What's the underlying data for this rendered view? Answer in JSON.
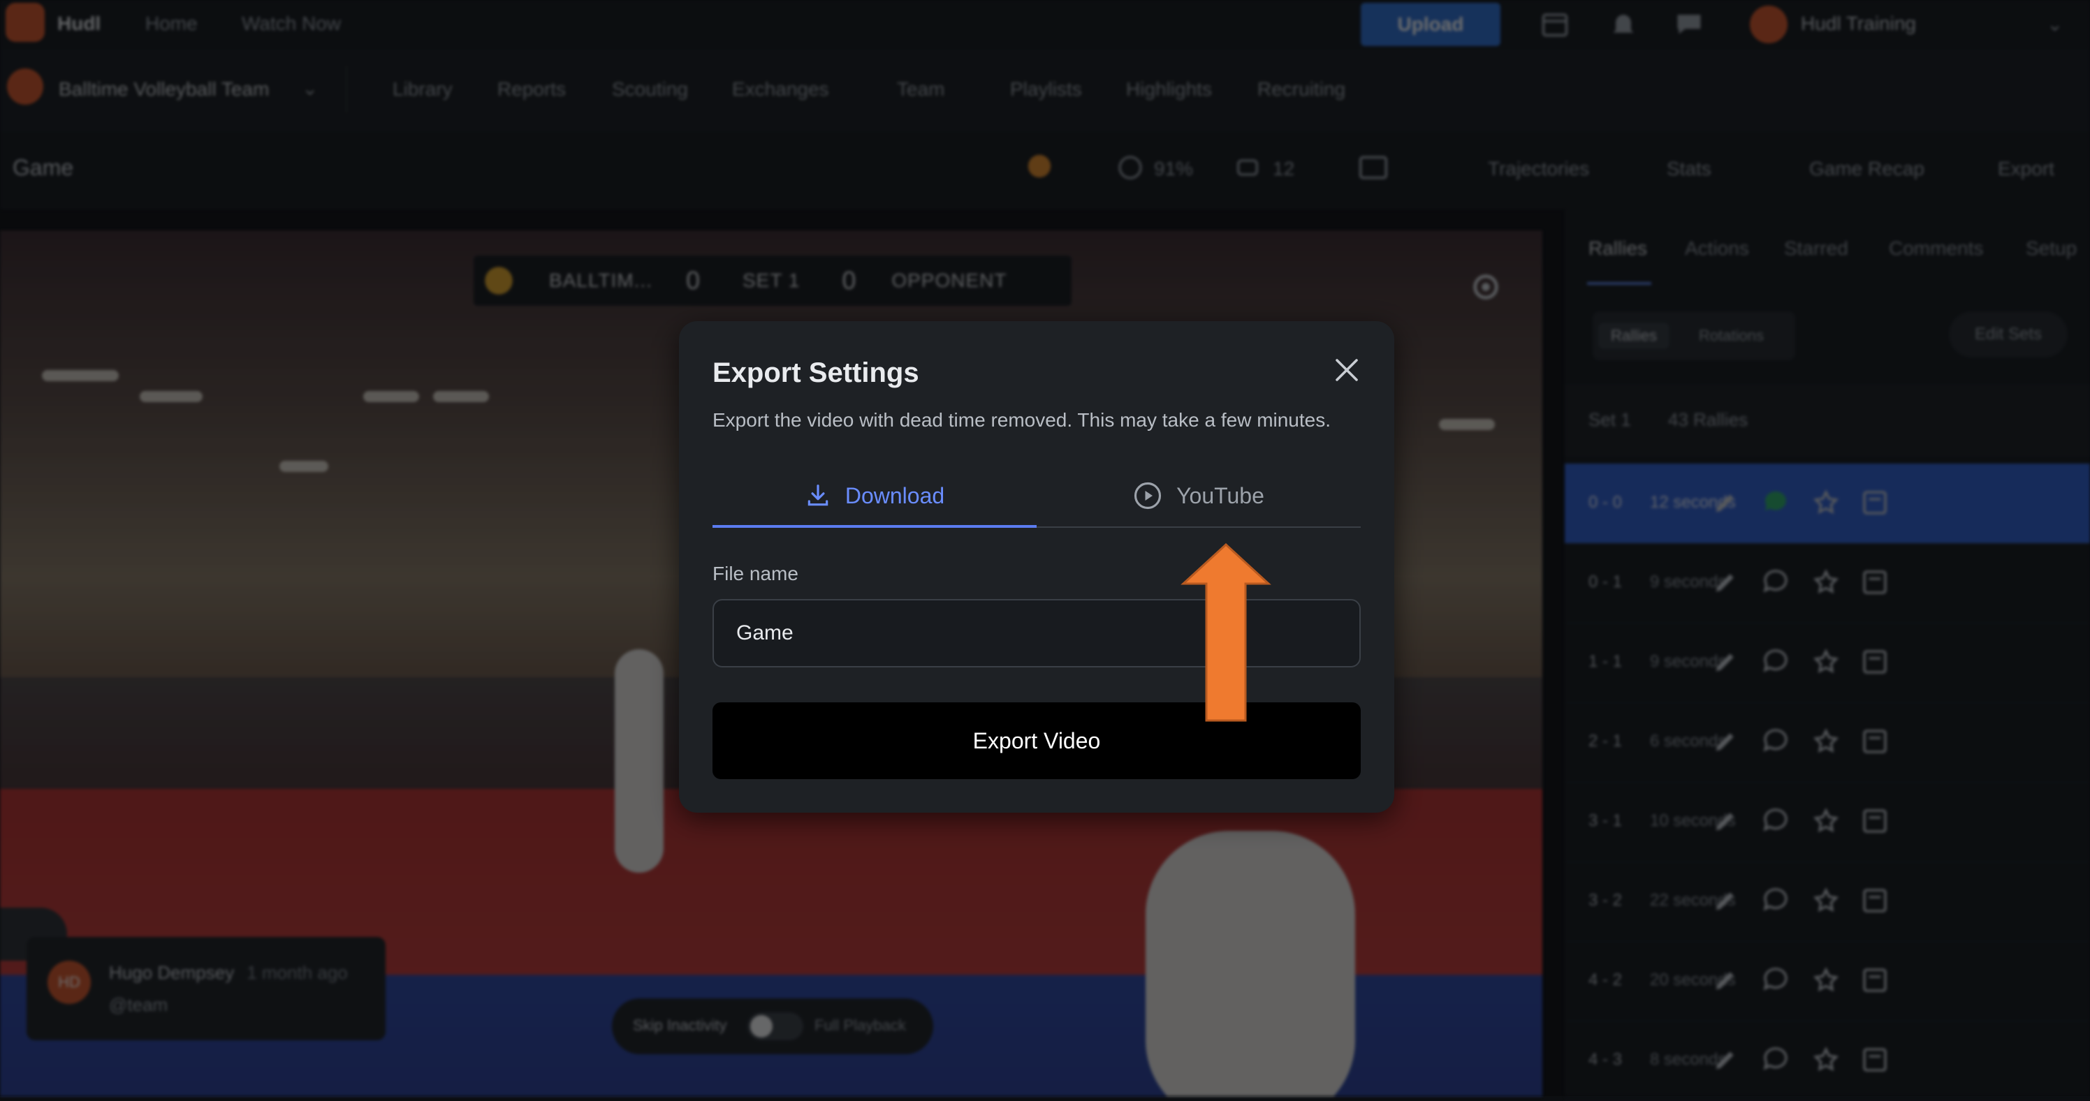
{
  "topnav": {
    "brand": "Hudl",
    "links": [
      "Home",
      "Watch Now"
    ],
    "upload_label": "Upload",
    "user_name": "Hudl Training"
  },
  "subnav": {
    "team_name": "Balltime Volleyball Team",
    "links": [
      "Library",
      "Reports",
      "Scouting",
      "Exchanges",
      "Team",
      "Playlists",
      "Highlights",
      "Recruiting"
    ]
  },
  "toolbar": {
    "title": "Game",
    "percent": "91%",
    "count": "12",
    "trajectories": "Trajectories",
    "stats": "Stats",
    "game_recap": "Game Recap",
    "export": "Export"
  },
  "video": {
    "scoreboard": {
      "team": "BALLTIM...",
      "team_score": "0",
      "set_label": "SET 1",
      "opp_score": "0",
      "opponent": "OPPONENT"
    },
    "comment": {
      "initials": "HD",
      "author": "Hugo Dempsey",
      "time": "1 month ago",
      "handle": "@team"
    },
    "toggle": {
      "left": "Skip Inactivity",
      "right": "Full Playback"
    }
  },
  "sidebar": {
    "tabs": [
      "Rallies",
      "Actions",
      "Starred",
      "Comments",
      "Setup"
    ],
    "segment": [
      "Rallies",
      "Rotations"
    ],
    "edit_sets": "Edit Sets",
    "set_label": "Set 1",
    "set_count": "43 Rallies",
    "rallies": [
      {
        "score": "0 - 0",
        "duration": "12 seconds"
      },
      {
        "score": "0 - 1",
        "duration": "9 seconds"
      },
      {
        "score": "1 - 1",
        "duration": "9 seconds"
      },
      {
        "score": "2 - 1",
        "duration": "6 seconds"
      },
      {
        "score": "3 - 1",
        "duration": "10 seconds"
      },
      {
        "score": "3 - 2",
        "duration": "22 seconds"
      },
      {
        "score": "4 - 2",
        "duration": "20 seconds"
      },
      {
        "score": "4 - 3",
        "duration": "8 seconds"
      }
    ]
  },
  "modal": {
    "title": "Export Settings",
    "description": "Export the video with dead time removed. This may take a few minutes.",
    "tab_download": "Download",
    "tab_youtube": "YouTube",
    "file_label": "File name",
    "file_value": "Game",
    "export_button": "Export Video"
  },
  "colors": {
    "accent": "#5b7cf0",
    "brand": "#d4562a",
    "arrow": "#ef7a2f",
    "active_rally": "#2f5fd0"
  }
}
